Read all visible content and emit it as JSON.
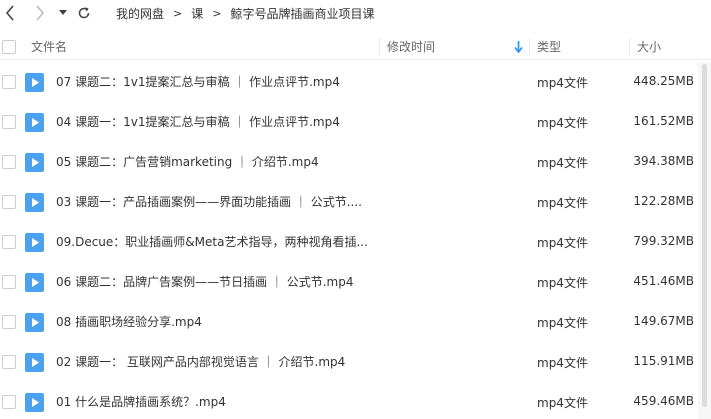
{
  "breadcrumb": {
    "items": [
      "我的网盘",
      "课",
      "鲸字号品牌插画商业项目课"
    ],
    "separator": ">"
  },
  "columns": {
    "name": "文件名",
    "modified": "修改时间",
    "type": "类型",
    "size": "大小"
  },
  "colors": {
    "accent": "#2d8cf0",
    "file_icon": "#4aa3f0",
    "header_text": "#666666"
  },
  "icons": {
    "back": "chevron-left-icon",
    "forward": "chevron-right-icon",
    "dropdown": "caret-down-icon",
    "refresh": "refresh-icon",
    "sort": "sort-down-arrow-icon",
    "file": "video-file-icon"
  },
  "files": [
    {
      "name": "07 课题二：1v1提案汇总与审稿 ｜ 作业点评节.mp4",
      "type": "mp4文件",
      "size": "448.25MB"
    },
    {
      "name": "04 课题一：1v1提案汇总与审稿 ｜ 作业点评节.mp4",
      "type": "mp4文件",
      "size": "161.52MB"
    },
    {
      "name": "05 课题二：广告营销marketing ｜ 介绍节.mp4",
      "type": "mp4文件",
      "size": "394.38MB"
    },
    {
      "name": "03 课题一：产品插画案例——界面功能插画 ｜ 公式节....",
      "type": "mp4文件",
      "size": "122.28MB"
    },
    {
      "name": "09.Decue：职业插画师&Meta艺术指导，两种视角看插...",
      "type": "mp4文件",
      "size": "799.32MB"
    },
    {
      "name": "06 课题二：品牌广告案例——节日插画 ｜ 公式节.mp4",
      "type": "mp4文件",
      "size": "451.46MB"
    },
    {
      "name": "08 插画职场经验分享.mp4",
      "type": "mp4文件",
      "size": "149.67MB"
    },
    {
      "name": "02 课题一： 互联网产品内部视觉语言 ｜ 介绍节.mp4",
      "type": "mp4文件",
      "size": "115.91MB"
    },
    {
      "name": "01 什么是品牌插画系统？.mp4",
      "type": "mp4文件",
      "size": "459.46MB"
    }
  ]
}
